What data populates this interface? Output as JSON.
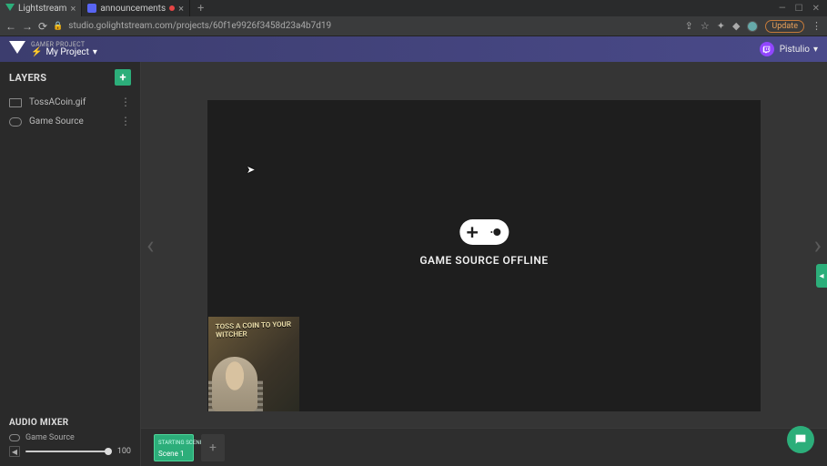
{
  "browser": {
    "tabs": [
      {
        "title": "Lightstream",
        "active": true
      },
      {
        "title": "announcements",
        "active": false,
        "indicator": "red"
      }
    ],
    "url": "studio.golightstream.com/projects/60f1e9926f3458d23a4b7d19",
    "update_label": "Update"
  },
  "header": {
    "kicker": "GAMER PROJECT",
    "project": "My Project",
    "user": "Pistulio"
  },
  "sidebar": {
    "layers_title": "LAYERS",
    "layers": [
      {
        "name": "TossACoin.gif",
        "type": "image"
      },
      {
        "name": "Game Source",
        "type": "game"
      }
    ],
    "mixer_title": "AUDIO MIXER",
    "mixer": {
      "source": "Game Source",
      "volume": 100
    }
  },
  "canvas": {
    "offline_label": "GAME SOURCE OFFLINE",
    "thumb_text": "TOSS A COIN TO YOUR WITCHER"
  },
  "scenes": {
    "starting_tag": "STARTING SCENE ⓘ",
    "items": [
      {
        "label": "Scene 1",
        "active": true
      }
    ]
  }
}
